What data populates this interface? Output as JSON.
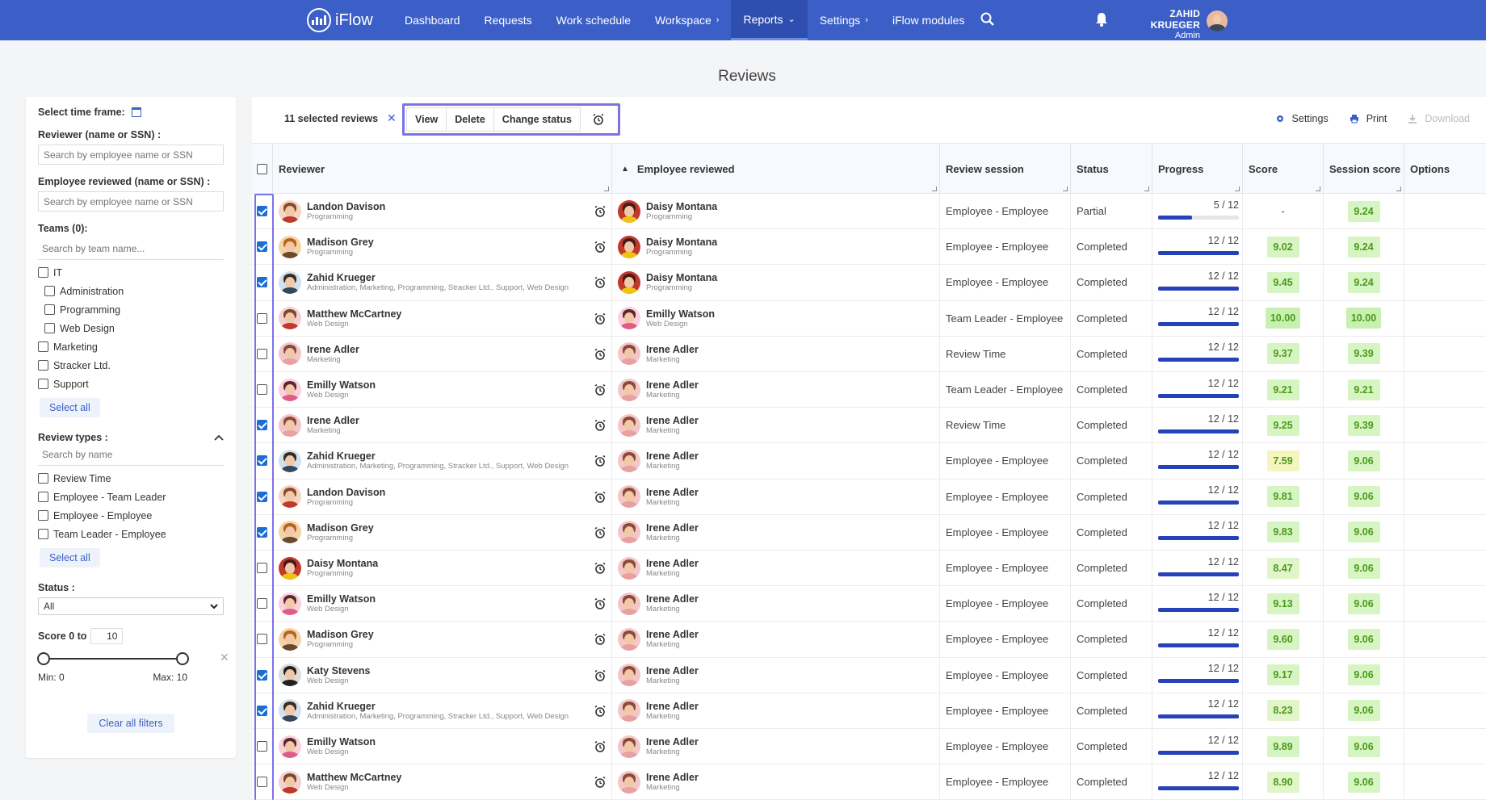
{
  "nav": {
    "brand": "iFlow",
    "links": [
      {
        "label": "Dashboard",
        "chev": ""
      },
      {
        "label": "Requests",
        "chev": ""
      },
      {
        "label": "Work schedule",
        "chev": ""
      },
      {
        "label": "Workspace",
        "chev": "›"
      },
      {
        "label": "Reports",
        "chev": "⌄",
        "active": true
      },
      {
        "label": "Settings",
        "chev": "›"
      },
      {
        "label": "iFlow modules",
        "chev": ""
      }
    ],
    "user_name": "ZAHID KRUEGER",
    "user_role": "Admin",
    "accent": "#3b5fc7"
  },
  "page_title": "Reviews",
  "sidebar": {
    "time_frame_label": "Select time frame:",
    "reviewer_label": "Reviewer (name or SSN) :",
    "reviewer_placeholder": "Search by employee name or SSN",
    "employee_label": "Employee reviewed (name or SSN) :",
    "employee_placeholder": "Search by employee name or SSN",
    "teams_label": "Teams (0):",
    "teams_placeholder": "Search by team name...",
    "teams": [
      {
        "label": "IT",
        "indent": false
      },
      {
        "label": "Administration",
        "indent": true
      },
      {
        "label": "Programming",
        "indent": true
      },
      {
        "label": "Web Design",
        "indent": true
      },
      {
        "label": "Marketing",
        "indent": false
      },
      {
        "label": "Stracker Ltd.",
        "indent": false
      },
      {
        "label": "Support",
        "indent": false
      }
    ],
    "select_all": "Select all",
    "review_types_label": "Review types :",
    "review_types_placeholder": "Search by name",
    "review_types": [
      "Review Time",
      "Employee - Team Leader",
      "Employee - Employee",
      "Team Leader - Employee"
    ],
    "status_label": "Status :",
    "status_value": "All",
    "score_label": "Score 0 to",
    "score_max_input": "10",
    "min_label": "Min: 0",
    "max_label": "Max: 10",
    "clear_filters": "Clear all filters"
  },
  "toolbar": {
    "selected_count": "11 selected reviews",
    "clear_x": "✕",
    "actions": [
      "View",
      "Delete",
      "Change status"
    ],
    "settings": "Settings",
    "print": "Print",
    "download": "Download"
  },
  "table": {
    "columns": [
      "Reviewer",
      "Employee reviewed",
      "Review session",
      "Status",
      "Progress",
      "Score",
      "Session score",
      "Options"
    ],
    "rows": [
      {
        "checked": true,
        "reviewer": {
          "name": "Landon Davison",
          "team": "Programming",
          "av": "landon"
        },
        "employee": {
          "name": "Daisy Montana",
          "team": "Programming",
          "av": "daisy"
        },
        "session": "Employee - Employee",
        "status": "Partial",
        "progress_label": "5 / 12",
        "progress": 0.4167,
        "score": "-",
        "score_color": "",
        "session_score": "9.24",
        "session_color": "#d6f5c2"
      },
      {
        "checked": true,
        "reviewer": {
          "name": "Madison Grey",
          "team": "Programming",
          "av": "madison"
        },
        "employee": {
          "name": "Daisy Montana",
          "team": "Programming",
          "av": "daisy"
        },
        "session": "Employee - Employee",
        "status": "Completed",
        "progress_label": "12 / 12",
        "progress": 1,
        "score": "9.02",
        "score_color": "#d6f5c2",
        "session_score": "9.24",
        "session_color": "#d6f5c2"
      },
      {
        "checked": true,
        "reviewer": {
          "name": "Zahid Krueger",
          "team": "Administration, Marketing, Programming, Stracker Ltd., Support, Web Design",
          "av": "zahid"
        },
        "employee": {
          "name": "Daisy Montana",
          "team": "Programming",
          "av": "daisy"
        },
        "session": "Employee - Employee",
        "status": "Completed",
        "progress_label": "12 / 12",
        "progress": 1,
        "score": "9.45",
        "score_color": "#d6f5c2",
        "session_score": "9.24",
        "session_color": "#d6f5c2"
      },
      {
        "checked": false,
        "reviewer": {
          "name": "Matthew McCartney",
          "team": "Web Design",
          "av": "matthew"
        },
        "employee": {
          "name": "Emilly Watson",
          "team": "Web Design",
          "av": "emilly"
        },
        "session": "Team Leader - Employee",
        "status": "Completed",
        "progress_label": "12 / 12",
        "progress": 1,
        "score": "10.00",
        "score_color": "#c8f0b0",
        "session_score": "10.00",
        "session_color": "#c8f0b0"
      },
      {
        "checked": false,
        "reviewer": {
          "name": "Irene Adler",
          "team": "Marketing",
          "av": "irene"
        },
        "employee": {
          "name": "Irene Adler",
          "team": "Marketing",
          "av": "irene"
        },
        "session": "Review Time",
        "status": "Completed",
        "progress_label": "12 / 12",
        "progress": 1,
        "score": "9.37",
        "score_color": "#d6f5c2",
        "session_score": "9.39",
        "session_color": "#d6f5c2"
      },
      {
        "checked": false,
        "reviewer": {
          "name": "Emilly Watson",
          "team": "Web Design",
          "av": "emilly"
        },
        "employee": {
          "name": "Irene Adler",
          "team": "Marketing",
          "av": "irene"
        },
        "session": "Team Leader - Employee",
        "status": "Completed",
        "progress_label": "12 / 12",
        "progress": 1,
        "score": "9.21",
        "score_color": "#d6f5c2",
        "session_score": "9.21",
        "session_color": "#d6f5c2"
      },
      {
        "checked": true,
        "reviewer": {
          "name": "Irene Adler",
          "team": "Marketing",
          "av": "irene"
        },
        "employee": {
          "name": "Irene Adler",
          "team": "Marketing",
          "av": "irene"
        },
        "session": "Review Time",
        "status": "Completed",
        "progress_label": "12 / 12",
        "progress": 1,
        "score": "9.25",
        "score_color": "#d6f5c2",
        "session_score": "9.39",
        "session_color": "#d6f5c2"
      },
      {
        "checked": true,
        "reviewer": {
          "name": "Zahid Krueger",
          "team": "Administration, Marketing, Programming, Stracker Ltd., Support, Web Design",
          "av": "zahid"
        },
        "employee": {
          "name": "Irene Adler",
          "team": "Marketing",
          "av": "irene"
        },
        "session": "Employee - Employee",
        "status": "Completed",
        "progress_label": "12 / 12",
        "progress": 1,
        "score": "7.59",
        "score_color": "#f5f5c0",
        "session_score": "9.06",
        "session_color": "#d6f5c2"
      },
      {
        "checked": true,
        "reviewer": {
          "name": "Landon Davison",
          "team": "Programming",
          "av": "landon"
        },
        "employee": {
          "name": "Irene Adler",
          "team": "Marketing",
          "av": "irene"
        },
        "session": "Employee - Employee",
        "status": "Completed",
        "progress_label": "12 / 12",
        "progress": 1,
        "score": "9.81",
        "score_color": "#d6f5c2",
        "session_score": "9.06",
        "session_color": "#d6f5c2"
      },
      {
        "checked": true,
        "reviewer": {
          "name": "Madison Grey",
          "team": "Programming",
          "av": "madison"
        },
        "employee": {
          "name": "Irene Adler",
          "team": "Marketing",
          "av": "irene"
        },
        "session": "Employee - Employee",
        "status": "Completed",
        "progress_label": "12 / 12",
        "progress": 1,
        "score": "9.83",
        "score_color": "#d6f5c2",
        "session_score": "9.06",
        "session_color": "#d6f5c2"
      },
      {
        "checked": false,
        "reviewer": {
          "name": "Daisy Montana",
          "team": "Programming",
          "av": "daisy"
        },
        "employee": {
          "name": "Irene Adler",
          "team": "Marketing",
          "av": "irene"
        },
        "session": "Employee - Employee",
        "status": "Completed",
        "progress_label": "12 / 12",
        "progress": 1,
        "score": "8.47",
        "score_color": "#e0f5c8",
        "session_score": "9.06",
        "session_color": "#d6f5c2"
      },
      {
        "checked": false,
        "reviewer": {
          "name": "Emilly Watson",
          "team": "Web Design",
          "av": "emilly"
        },
        "employee": {
          "name": "Irene Adler",
          "team": "Marketing",
          "av": "irene"
        },
        "session": "Employee - Employee",
        "status": "Completed",
        "progress_label": "12 / 12",
        "progress": 1,
        "score": "9.13",
        "score_color": "#d6f5c2",
        "session_score": "9.06",
        "session_color": "#d6f5c2"
      },
      {
        "checked": false,
        "reviewer": {
          "name": "Madison Grey",
          "team": "Programming",
          "av": "madison"
        },
        "employee": {
          "name": "Irene Adler",
          "team": "Marketing",
          "av": "irene"
        },
        "session": "Employee - Employee",
        "status": "Completed",
        "progress_label": "12 / 12",
        "progress": 1,
        "score": "9.60",
        "score_color": "#d6f5c2",
        "session_score": "9.06",
        "session_color": "#d6f5c2"
      },
      {
        "checked": true,
        "reviewer": {
          "name": "Katy Stevens",
          "team": "Web Design",
          "av": "katy"
        },
        "employee": {
          "name": "Irene Adler",
          "team": "Marketing",
          "av": "irene"
        },
        "session": "Employee - Employee",
        "status": "Completed",
        "progress_label": "12 / 12",
        "progress": 1,
        "score": "9.17",
        "score_color": "#d6f5c2",
        "session_score": "9.06",
        "session_color": "#d6f5c2"
      },
      {
        "checked": true,
        "reviewer": {
          "name": "Zahid Krueger",
          "team": "Administration, Marketing, Programming, Stracker Ltd., Support, Web Design",
          "av": "zahid"
        },
        "employee": {
          "name": "Irene Adler",
          "team": "Marketing",
          "av": "irene"
        },
        "session": "Employee - Employee",
        "status": "Completed",
        "progress_label": "12 / 12",
        "progress": 1,
        "score": "8.23",
        "score_color": "#e0f5c8",
        "session_score": "9.06",
        "session_color": "#d6f5c2"
      },
      {
        "checked": false,
        "reviewer": {
          "name": "Emilly Watson",
          "team": "Web Design",
          "av": "emilly"
        },
        "employee": {
          "name": "Irene Adler",
          "team": "Marketing",
          "av": "irene"
        },
        "session": "Employee - Employee",
        "status": "Completed",
        "progress_label": "12 / 12",
        "progress": 1,
        "score": "9.89",
        "score_color": "#d6f5c2",
        "session_score": "9.06",
        "session_color": "#d6f5c2"
      },
      {
        "checked": false,
        "reviewer": {
          "name": "Matthew McCartney",
          "team": "Web Design",
          "av": "matthew"
        },
        "employee": {
          "name": "Irene Adler",
          "team": "Marketing",
          "av": "irene"
        },
        "session": "Employee - Employee",
        "status": "Completed",
        "progress_label": "12 / 12",
        "progress": 1,
        "score": "8.90",
        "score_color": "#e0f5c8",
        "session_score": "9.06",
        "session_color": "#d6f5c2"
      }
    ]
  },
  "avatar_colors": {
    "landon": {
      "bg": "#f6d5c5",
      "shirt": "#c0392b",
      "hair": "#8a4b2a"
    },
    "madison": {
      "bg": "#f3d3a8",
      "shirt": "#6b4a2b",
      "hair": "#b5651d"
    },
    "zahid": {
      "bg": "#d0e2ef",
      "shirt": "#34495e",
      "hair": "#3d2b1f"
    },
    "matthew": {
      "bg": "#f5d0d0",
      "shirt": "#c0392b",
      "hair": "#7a4a2a"
    },
    "irene": {
      "bg": "#f3c7c7",
      "shirt": "#e8a0a0",
      "hair": "#8b4a3a"
    },
    "emilly": {
      "bg": "#fbd0dc",
      "shirt": "#e05a8a",
      "hair": "#5a2a2a"
    },
    "daisy": {
      "bg": "#c0392b",
      "shirt": "#f1c40f",
      "hair": "#4a1a1a"
    },
    "katy": {
      "bg": "#dcdcdc",
      "shirt": "#222222",
      "hair": "#222222"
    }
  }
}
